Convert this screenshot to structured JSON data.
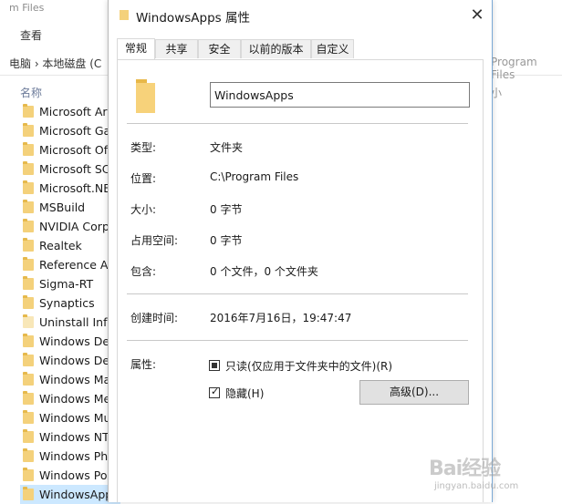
{
  "explorer": {
    "title": "m Files",
    "ribbon_view": "查看",
    "breadcrumb": "电脑 › 本地磁盘 (C",
    "address_right": "Program Files",
    "column_name": "名称",
    "column_size": "小",
    "items": [
      "Microsoft Ar",
      "Microsoft Ga",
      "Microsoft Of",
      "Microsoft SC",
      "Microsoft.NE",
      "MSBuild",
      "NVIDIA Corp",
      "Realtek",
      "Reference As",
      "Sigma-RT",
      "Synaptics",
      "Uninstall Info",
      "Windows Def",
      "Windows Def",
      "Windows Ma",
      "Windows Me",
      "Windows Mu",
      "Windows NT",
      "Windows Pho",
      "Windows Por",
      "WindowsApp"
    ]
  },
  "dialog": {
    "title": "WindowsApps 属性",
    "close_glyph": "✕",
    "tabs": [
      "常规",
      "共享",
      "安全",
      "以前的版本",
      "自定义"
    ],
    "folder_name": "WindowsApps",
    "props": {
      "type_label": "类型:",
      "type_value": "文件夹",
      "location_label": "位置:",
      "location_value": "C:\\Program Files",
      "size_label": "大小:",
      "size_value": "0 字节",
      "disk_label": "占用空间:",
      "disk_value": "0 字节",
      "contains_label": "包含:",
      "contains_value": "0 个文件，0 个文件夹",
      "created_label": "创建时间:",
      "created_value": "2016年7月16日，19:47:47",
      "attributes_label": "属性:"
    },
    "readonly_label": "只读(仅应用于文件夹中的文件)(R)",
    "hidden_label": "隐藏(H)",
    "hidden_mark": "✓",
    "advanced_label": "高级(D)..."
  },
  "watermark": {
    "brand": "Bai经验",
    "url": "jingyan.baidu.com"
  }
}
